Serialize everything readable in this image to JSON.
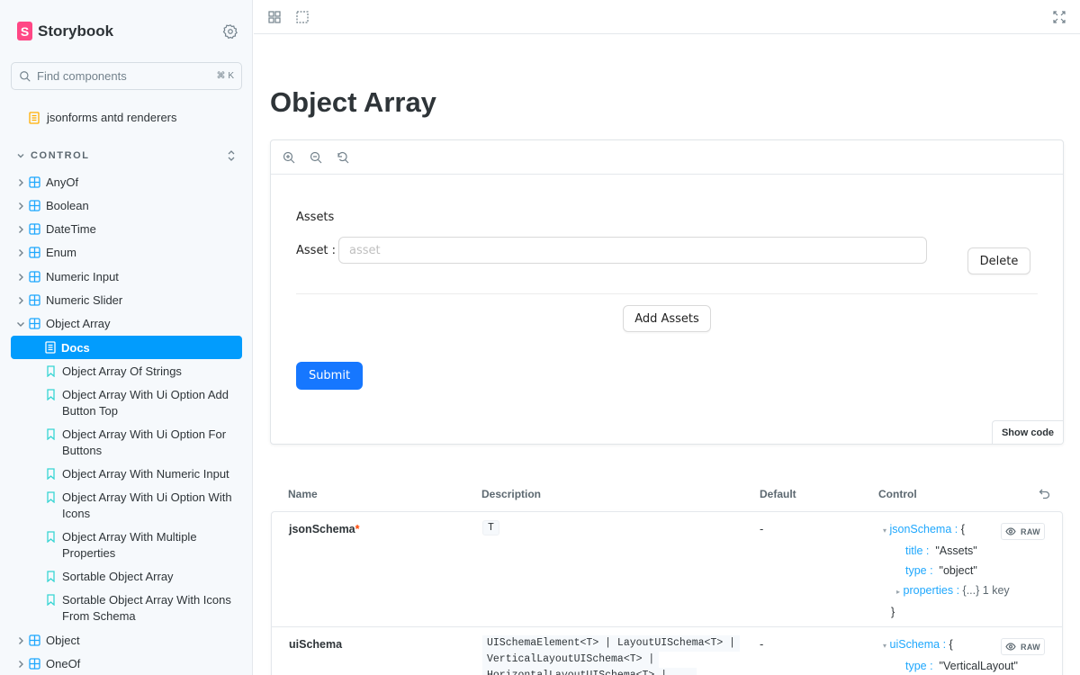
{
  "sidebar": {
    "brand": "Storybook",
    "brand_letter": "S",
    "search": {
      "placeholder": "Find components",
      "shortcut": "⌘ K"
    },
    "root_doc": "jsonforms antd renderers",
    "group": "CONTROL",
    "components_before": [
      "AnyOf",
      "Boolean",
      "DateTime",
      "Enum",
      "Numeric Input",
      "Numeric Slider",
      "Object Array"
    ],
    "active_doc": "Docs",
    "stories": [
      "Object Array Of Strings",
      "Object Array With Ui Option Add Button Top",
      "Object Array With Ui Option For Buttons",
      "Object Array With Numeric Input",
      "Object Array With Ui Option With Icons",
      "Object Array With Multiple Properties",
      "Sortable Object Array",
      "Sortable Object Array With Icons From Schema"
    ],
    "components_after": [
      "Object",
      "OneOf"
    ]
  },
  "main": {
    "title": "Object Array",
    "preview": {
      "section_title": "Assets",
      "field_label": "Asset",
      "field_placeholder": "asset",
      "delete_label": "Delete",
      "add_label": "Add Assets",
      "submit_label": "Submit",
      "show_code_label": "Show code"
    },
    "args_table": {
      "headers": {
        "name": "Name",
        "description": "Description",
        "default": "Default",
        "control": "Control"
      },
      "rows": [
        {
          "name": "jsonSchema",
          "required_mark": "*",
          "type": "T",
          "default": "-",
          "control": {
            "root_key": "jsonSchema",
            "raw_label": "RAW",
            "title_key": "title",
            "title_value": "\"Assets\"",
            "type_key": "type",
            "type_value": "\"object\"",
            "props_key": "properties",
            "props_value": "{...}",
            "props_count": "1 key"
          }
        },
        {
          "name": "uiSchema",
          "type_lines": [
            "UISchemaElement<T> | LayoutUISchema<T> |",
            "VerticalLayoutUISchema<T> |",
            "HorizontalLayoutUISchema<T> | ..."
          ],
          "default": "-",
          "control": {
            "root_key": "uiSchema",
            "raw_label": "RAW",
            "type_key": "type",
            "type_value": "\"VerticalLayout\""
          }
        }
      ]
    }
  }
}
